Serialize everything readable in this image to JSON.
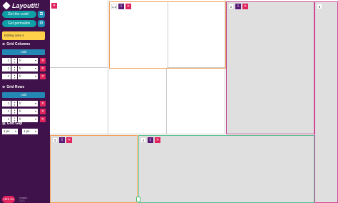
{
  "sidebar": {
    "brand": "Layoutit!",
    "get_code": "Get the code!",
    "get_permalink": "Get permalink",
    "editing": "Editing area 4",
    "grid_columns_title": "Grid Columns",
    "grid_rows_title": "Grid Rows",
    "grid_gap_title": "Grid Gap",
    "add_label": "Add",
    "columns": [
      {
        "value": "1",
        "unit": "fr"
      },
      {
        "value": "1",
        "unit": "fr"
      },
      {
        "value": "1",
        "unit": "fr"
      }
    ],
    "rows": [
      {
        "value": "1",
        "unit": "fr"
      },
      {
        "value": "1",
        "unit": "fr"
      },
      {
        "value": "1",
        "unit": "fr"
      }
    ],
    "gap": [
      {
        "value": "1",
        "unit": "px"
      },
      {
        "value": "1",
        "unit": "px"
      }
    ],
    "hire_label": "Hire us",
    "version_line1": "version",
    "version_line2": "1.2.1",
    "icon_names": [
      "layout-logo-icon",
      "code-icon",
      "link-icon",
      "grid-icon",
      "grid-rows-icon",
      "gap-icon",
      "delete-icon"
    ]
  },
  "areas": [
    {
      "num": "1",
      "color": "#e23b79"
    },
    {
      "num": "2",
      "color": "#9e3ea0"
    },
    {
      "num": "3",
      "color": "#f39b50"
    },
    {
      "num": "4",
      "color": "#56c08e"
    },
    {
      "num": "5",
      "color": "#e3b43f"
    }
  ],
  "cell_labels": {
    "c1": "1",
    "c2": "1.1",
    "c3": "3"
  },
  "colors": {
    "sidebar_bg": "#40124b",
    "teal": "#0f9fa6",
    "pink": "#e0245e",
    "yellow": "#ffd14b",
    "grid_gray": "#dfdfdf"
  }
}
